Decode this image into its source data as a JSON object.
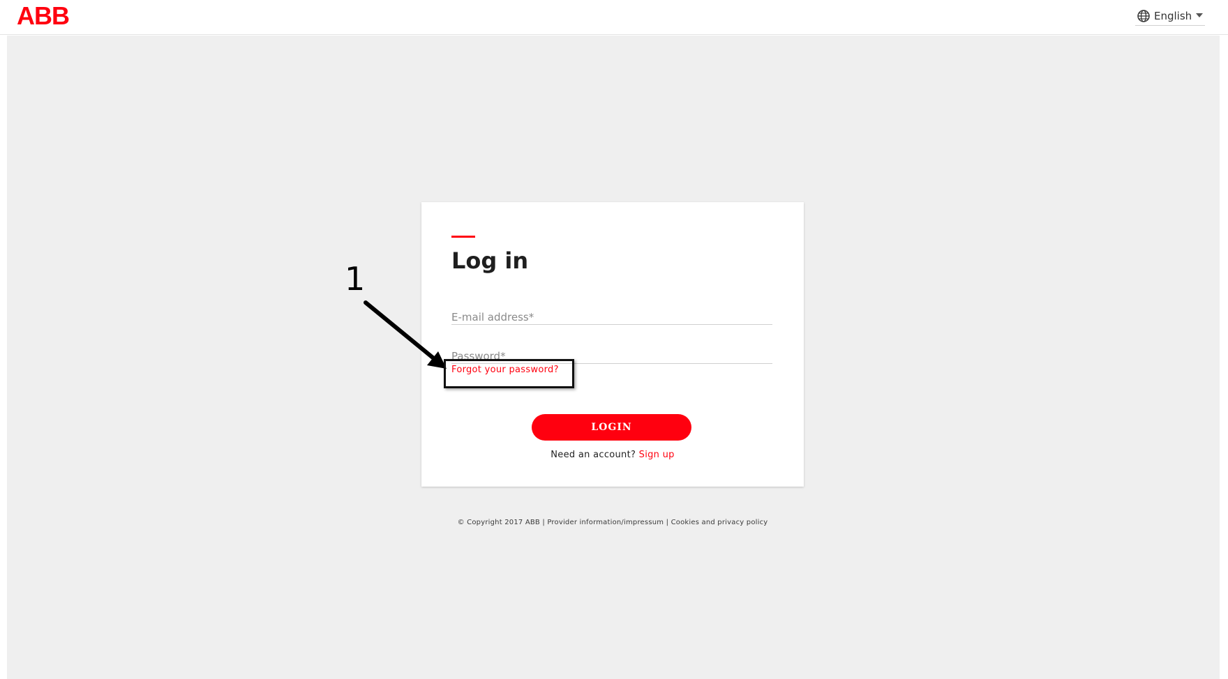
{
  "header": {
    "logo_text": "ABB",
    "language": {
      "label": "English",
      "icon": "globe-icon"
    }
  },
  "login": {
    "title": "Log in",
    "email_placeholder": "E-mail address*",
    "password_placeholder": "Password*",
    "forgot_link": "Forgot your password?",
    "login_button": "LOGIN",
    "signup_prompt": "Need an account?",
    "signup_link": "Sign up"
  },
  "footer": {
    "copyright": "© Copyright 2017 ABB",
    "separator": "|",
    "provider_link": "Provider information/impressum",
    "privacy_link": "Cookies and privacy policy"
  },
  "annotation": {
    "number": "1"
  },
  "colors": {
    "brand_red": "#ff000f",
    "background": "#efefef"
  }
}
